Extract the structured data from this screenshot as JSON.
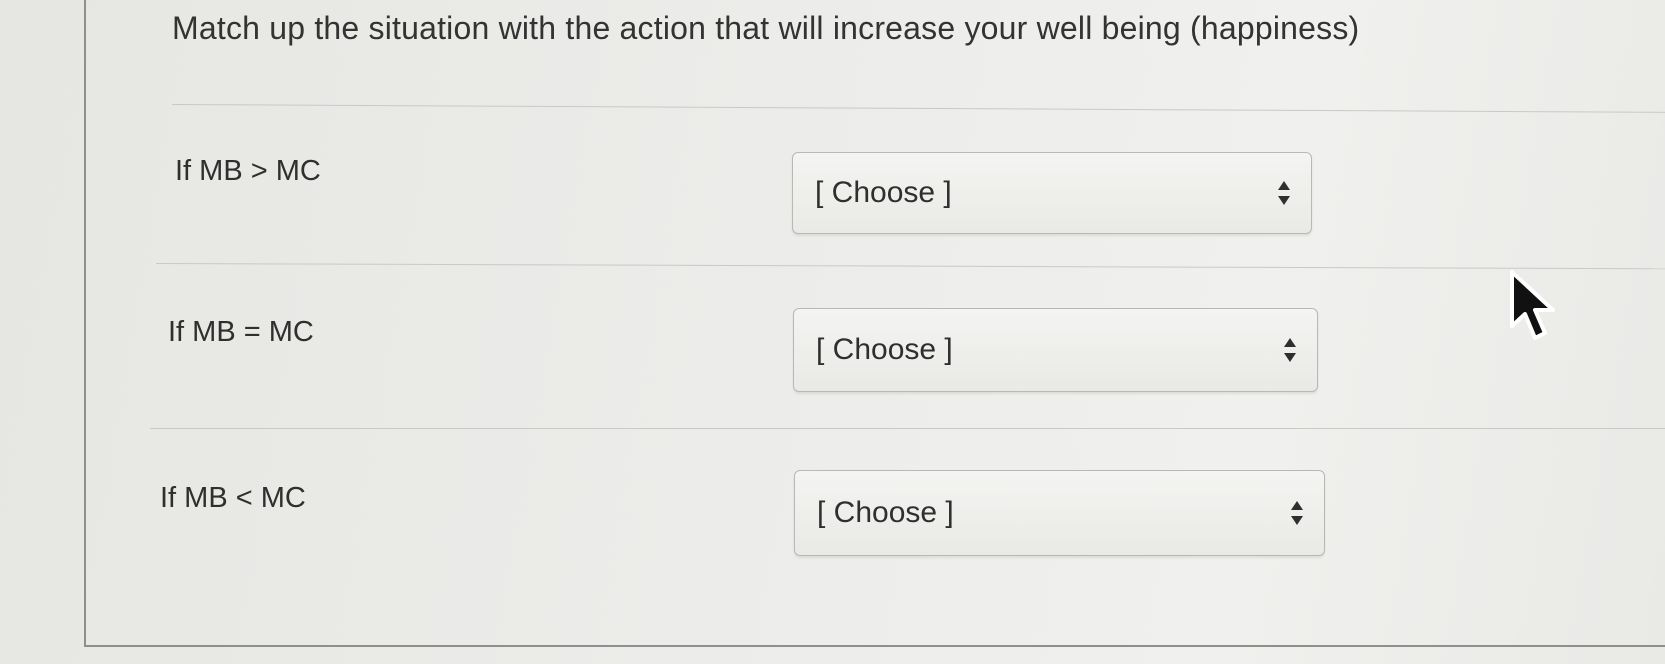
{
  "question": {
    "title": "Match up the situation with the action that will increase your well being (happiness)"
  },
  "rows": [
    {
      "situation": "If MB > MC",
      "selected": "[ Choose ]"
    },
    {
      "situation": "If MB = MC",
      "selected": "[ Choose ]"
    },
    {
      "situation": "If MB < MC",
      "selected": "[ Choose ]"
    }
  ],
  "icons": {
    "select_arrow": "updown-arrows-icon",
    "pointer": "mouse-cursor-icon"
  },
  "colors": {
    "background": "#ececea",
    "text": "#2f2f2f",
    "select_border": "#b8b8b4"
  }
}
